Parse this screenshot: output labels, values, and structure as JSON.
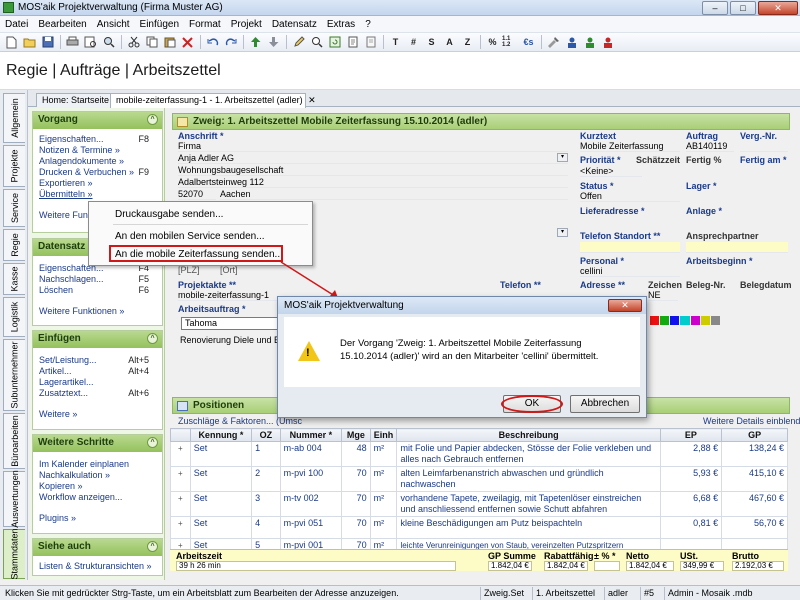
{
  "window": {
    "title": "MOS'aik Projektverwaltung (Firma Muster AG)",
    "minimize": "–",
    "maximize": "□",
    "close": "✕"
  },
  "menu": [
    "Datei",
    "Bearbeiten",
    "Ansicht",
    "Einfügen",
    "Format",
    "Projekt",
    "Datensatz",
    "Extras",
    "?"
  ],
  "toolbar": {
    "icons": [
      "new-icon",
      "open-icon",
      "save-icon",
      "print-icon",
      "print-preview-icon",
      "preview-icon",
      "cut-icon",
      "copy-icon",
      "paste-icon",
      "delete-icon",
      "undo-icon",
      "redo-icon",
      "up-icon",
      "down-icon",
      "edit-icon",
      "search-icon",
      "refresh-icon",
      "copy-doc-icon",
      "paste-doc-icon"
    ],
    "text_buttons": [
      "T",
      "#",
      "S",
      "A",
      "Z",
      "%",
      "1.1 1.2",
      "€s"
    ]
  },
  "page_title": "Regie | Aufträge | Arbeitszettel",
  "vtabs": [
    "Allgemein",
    "Projekte",
    "Service",
    "Regie",
    "Kasse",
    "Logistik",
    "Subunternehmer",
    "Büroarbeiten",
    "Auswertungen",
    "Stammdaten"
  ],
  "doctabs": [
    "Home: Startseite",
    "mobile-zeiterfassung-1 - 1. Arbeitszettel (adler)"
  ],
  "doctab_close": "✕",
  "left_panel": {
    "collapse_glyph": "^",
    "vorgang": {
      "title": "Vorgang",
      "items": [
        {
          "label": "Eigenschaften...",
          "key": "F8"
        },
        {
          "label": "Notizen & Termine »",
          "key": ""
        },
        {
          "label": "Anlagendokumente »",
          "key": ""
        },
        {
          "label": "Drucken & Verbuchen »",
          "key": "F9"
        },
        {
          "label": "Exportieren »",
          "key": ""
        },
        {
          "label": "Übermitteln »",
          "key": ""
        }
      ],
      "more": "Weitere Funktionen »"
    },
    "datensatz": {
      "title": "Datensatz",
      "items": [
        {
          "label": "Eigenschaften...",
          "key": "F4"
        },
        {
          "label": "Nachschlagen...",
          "key": "F5"
        },
        {
          "label": "Löschen",
          "key": "F6"
        }
      ],
      "more": "Weitere Funktionen »"
    },
    "einfuegen": {
      "title": "Einfügen",
      "items": [
        {
          "label": "Set/Leistung...",
          "key": "Alt+5"
        },
        {
          "label": "Artikel...",
          "key": "Alt+4"
        },
        {
          "label": "Lagerartikel...",
          "key": ""
        },
        {
          "label": "Zusatztext...",
          "key": "Alt+6"
        }
      ],
      "more": "Weitere »"
    },
    "weitere_schritte": {
      "title": "Weitere Schritte",
      "items": [
        {
          "label": "Im Kalender einplanen",
          "key": ""
        },
        {
          "label": "Nachkalkulation »",
          "key": ""
        },
        {
          "label": "Kopieren »",
          "key": ""
        },
        {
          "label": "Workflow anzeigen...",
          "key": ""
        }
      ],
      "more": "Plugins »"
    },
    "siehe_auch": {
      "title": "Siehe auch",
      "items": [
        {
          "label": "Listen & Strukturansichten »",
          "key": ""
        }
      ]
    }
  },
  "form": {
    "header": "Zweig: 1. Arbeitszettel Mobile Zeiterfassung 15.10.2014 (adler)",
    "anschrift_label": "Anschrift *",
    "anschrift": [
      "Firma",
      "Anja Adler AG",
      "Wohnungsbaugesellschaft",
      "Adalbertsteinweg 112"
    ],
    "plz": "52070",
    "ort": "Aachen",
    "plz_placeholder": "[PLZ]",
    "ort_placeholder": "[Ort]",
    "projektakte_label": "Projektakte **",
    "projektakte": "mobile-zeiterfassung-1",
    "telefon_label": "Telefon **",
    "arbeitsauftrag_label": "Arbeitsauftrag *",
    "font_name": "Tahoma",
    "arbeitsauftrag_text": "Renovierung Diele und Ein",
    "kurztext_label": "Kurztext",
    "kurztext": "Mobile Zeiterfassung",
    "auftrag_label": "Auftrag",
    "auftrag": "AB140119",
    "verg_label": "Verg.-Nr.",
    "prioritaet_label": "Priorität *",
    "prioritaet": "<Keine>",
    "schaetzzeit_label": "Schätzzeit",
    "fertig_label": "Fertig %",
    "fertig_am_label": "Fertig am *",
    "status_label": "Status *",
    "status": "Offen",
    "lager_label": "Lager *",
    "lieferadresse_label": "Lieferadresse *",
    "anlage_label": "Anlage *",
    "telefon_standort_label": "Telefon Standort **",
    "ansprechpartner_label": "Ansprechpartner",
    "personal_label": "Personal *",
    "personal": "cellini",
    "arbeitsbeginn_label": "Arbeitsbeginn *",
    "adresse_label": "Adresse **",
    "zeichen_label": "Zeichen",
    "zeichen": "NE",
    "belegnr_label": "Beleg-Nr.",
    "belegdatum_label": "Belegdatum",
    "dropdown_glyph": "▾"
  },
  "positions": {
    "title": "Positionen",
    "subtitle": "Zuschläge & Faktoren... (Umsc",
    "details_link": "Weitere Details einblenden",
    "expander": "+",
    "headers": [
      "Kennung *",
      "OZ",
      "Nummer *",
      "Mge",
      "Einh",
      "Beschreibung",
      "EP",
      "GP"
    ],
    "rows": [
      {
        "kennung": "Set",
        "oz": "1",
        "nummer": "m-ab 004",
        "mge": "48",
        "einh": "m²",
        "beschreibung": "mit Folie und Papier abdecken, Stösse der Folie verkleben und alles nach Gebrauch entfernen",
        "ep": "2,88 €",
        "gp": "138,24 €"
      },
      {
        "kennung": "Set",
        "oz": "2",
        "nummer": "m-pvi 100",
        "mge": "70",
        "einh": "m²",
        "beschreibung": "alten Leimfarbenanstrich abwaschen und gründlich nachwaschen",
        "ep": "5,93 €",
        "gp": "415,10 €"
      },
      {
        "kennung": "Set",
        "oz": "3",
        "nummer": "m-tv 002",
        "mge": "70",
        "einh": "m²",
        "beschreibung": "vorhandene Tapete, zweilagig, mit Tapetenlöser einstreichen und anschliessend entfernen sowie Schutt abfahren",
        "ep": "6,68 €",
        "gp": "467,60 €"
      },
      {
        "kennung": "Set",
        "oz": "4",
        "nummer": "m-pvi 051",
        "mge": "70",
        "einh": "m²",
        "beschreibung": "kleine Beschädigungen am Putz beispachteln",
        "ep": "0,81 €",
        "gp": "56,70 €"
      },
      {
        "kennung": "Set",
        "oz": "5",
        "nummer": "m-pvi 001",
        "mge": "70",
        "einh": "m²",
        "beschreibung": "leichte Verunreinigungen von Staub, vereinzelten Putzspritzern",
        "ep": "",
        "gp": ""
      }
    ]
  },
  "totals": {
    "arbeitszeit_label": "Arbeitszeit",
    "arbeitszeit": "39 h 26 min",
    "gp_summe_label": "GP Summe",
    "gp_summe": "1.842,04 €",
    "rabattfaehig_label": "Rabattfähig",
    "rabattfaehig": "1.842,04 €",
    "prozent_label": "± % *",
    "netto_label": "Netto",
    "netto": "1.842,04 €",
    "ust_label": "USt.",
    "ust": "349,99 €",
    "brutto_label": "Brutto",
    "brutto": "2.192,03 €"
  },
  "statusbar": {
    "hint": "Klicken Sie mit gedrückter Strg-Taste, um ein Arbeitsblatt zum Bearbeiten der Adresse anzuzeigen.",
    "cells": [
      "Zweig.Set",
      "1. Arbeitszettel",
      "adler",
      "#5",
      "Admin - Mosaik .mdb"
    ]
  },
  "context_menu": {
    "items": [
      "Druckausgabe senden...",
      "An den mobilen Service senden...",
      "An die mobile Zeiterfassung senden..."
    ]
  },
  "dialog": {
    "title": "MOS'aik Projektverwaltung",
    "message": "Der Vorgang 'Zweig: 1. Arbeitszettel Mobile Zeiterfassung 15.10.2014 (adler)' wird an den Mitarbeiter 'cellini' übermittelt.",
    "ok": "OK",
    "cancel": "Abbrechen",
    "close": "✕",
    "warning_glyph": "!"
  }
}
